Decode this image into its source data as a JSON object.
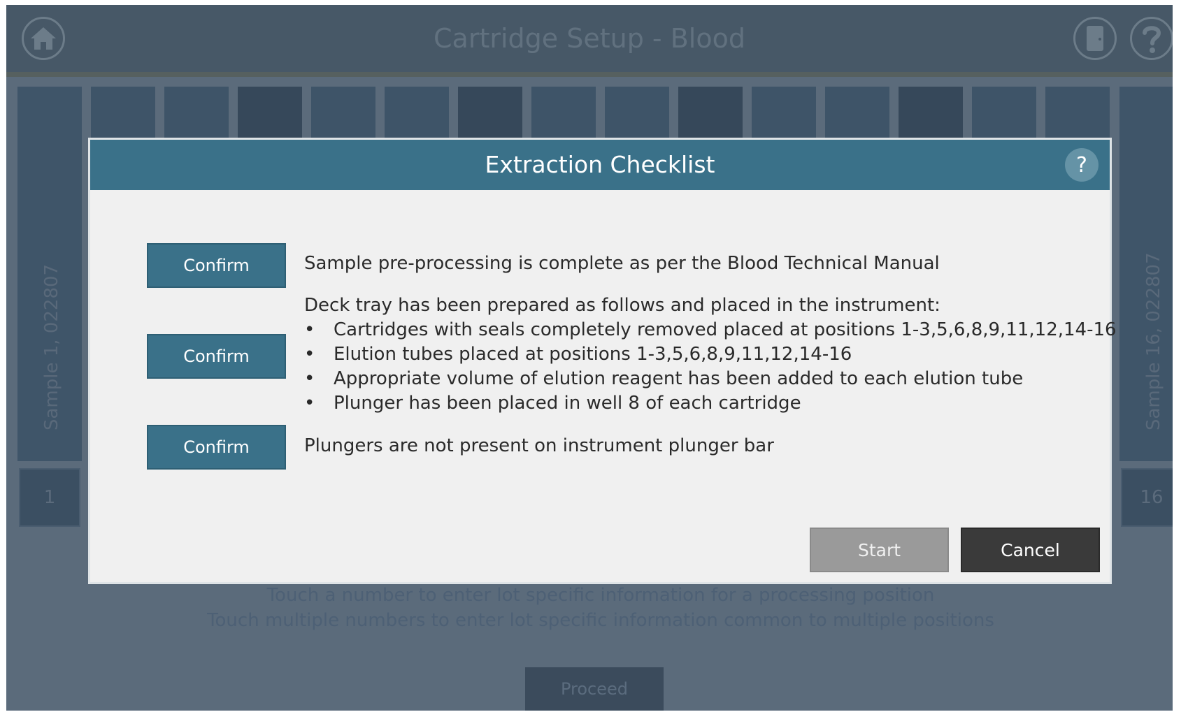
{
  "header": {
    "title": "Cartridge Setup - Blood",
    "home_icon": "home-icon",
    "exit_icon": "exit-door-icon",
    "help_icon": "help-icon"
  },
  "samples": {
    "left_label": "Sample 1, 022807",
    "right_label": "Sample 16, 022807",
    "left_number": "1",
    "right_number": "16"
  },
  "hints": {
    "line1": "Touch a number to enter lot specific information for a processing position",
    "line2": "Touch multiple numbers to enter lot specific information common to multiple positions"
  },
  "proceed_label": "Proceed",
  "dialog": {
    "title": "Extraction Checklist",
    "help_label": "?",
    "items": [
      {
        "confirm_label": "Confirm",
        "text": "Sample pre-processing is complete as per the Blood Technical Manual"
      },
      {
        "confirm_label": "Confirm",
        "text": "Deck tray has been prepared as follows and placed in the instrument:",
        "bullets": [
          "Cartridges with seals completely removed placed at positions 1-3,5,6,8,9,11,12,14-16",
          "Elution tubes placed at positions 1-3,5,6,8,9,11,12,14-16",
          "Appropriate volume of elution reagent has been added to each elution tube",
          "Plunger has been placed in well 8 of each cartridge"
        ]
      },
      {
        "confirm_label": "Confirm",
        "text": "Plungers are not present on instrument plunger bar"
      }
    ],
    "start_label": "Start",
    "cancel_label": "Cancel"
  },
  "colors": {
    "dialog_header": "#3a7189",
    "confirm_button": "#3a7189",
    "start_disabled": "#9a9a9a",
    "cancel_button": "#3a3a3a"
  }
}
